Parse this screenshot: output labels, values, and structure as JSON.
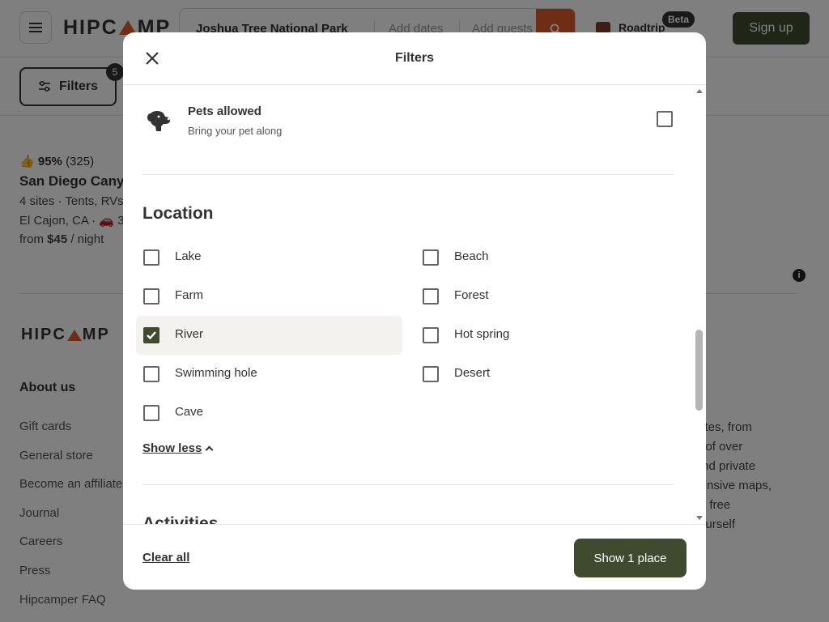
{
  "header": {
    "logo": "HIPCAMP",
    "search": {
      "location": "Joshua Tree National Park",
      "dates_placeholder": "Add dates",
      "guests_placeholder": "Add guests"
    },
    "roadtrip_label": "Roadtrip",
    "beta_badge": "Beta",
    "signup_label": "Sign up"
  },
  "filter_bar": {
    "filters_label": "Filters",
    "filters_count": "5"
  },
  "listing": {
    "rating_pct": "95%",
    "rating_count": "(325)",
    "name": "San Diego Canyo",
    "details": "4 sites · Tents, RVs",
    "location": "El Cajon, CA ·",
    "drive_suffix": "3",
    "price_prefix": "from",
    "price": "$45",
    "price_suffix": "/ night"
  },
  "footer": {
    "logo": "HIPCAMP",
    "about_heading": "About us",
    "links": [
      "Gift cards",
      "General store",
      "Become an affiliate",
      "Journal",
      "Careers",
      "Press",
      "Hipcamper FAQ"
    ],
    "text_lines": [
      "apsites, from",
      "tion of over",
      "s, and private",
      "rehensive maps,",
      "eate free",
      "d yourself"
    ]
  },
  "modal": {
    "title": "Filters",
    "pets": {
      "title": "Pets allowed",
      "subtitle": "Bring your pet along",
      "checked": false
    },
    "location_heading": "Location",
    "location_options": [
      {
        "label": "Lake",
        "checked": false
      },
      {
        "label": "Beach",
        "checked": false
      },
      {
        "label": "Farm",
        "checked": false
      },
      {
        "label": "Forest",
        "checked": false
      },
      {
        "label": "River",
        "checked": true
      },
      {
        "label": "Hot spring",
        "checked": false
      },
      {
        "label": "Swimming hole",
        "checked": false
      },
      {
        "label": "Desert",
        "checked": false
      },
      {
        "label": "Cave",
        "checked": false
      }
    ],
    "show_less_label": "Show less",
    "next_section_heading": "Activities",
    "clear_all_label": "Clear all",
    "show_places_label": "Show 1 place"
  },
  "colors": {
    "primary": "#3f4a2e",
    "accent": "#e05a2a",
    "text": "#333333",
    "overlay": "rgba(0,0,0,0.5)"
  }
}
